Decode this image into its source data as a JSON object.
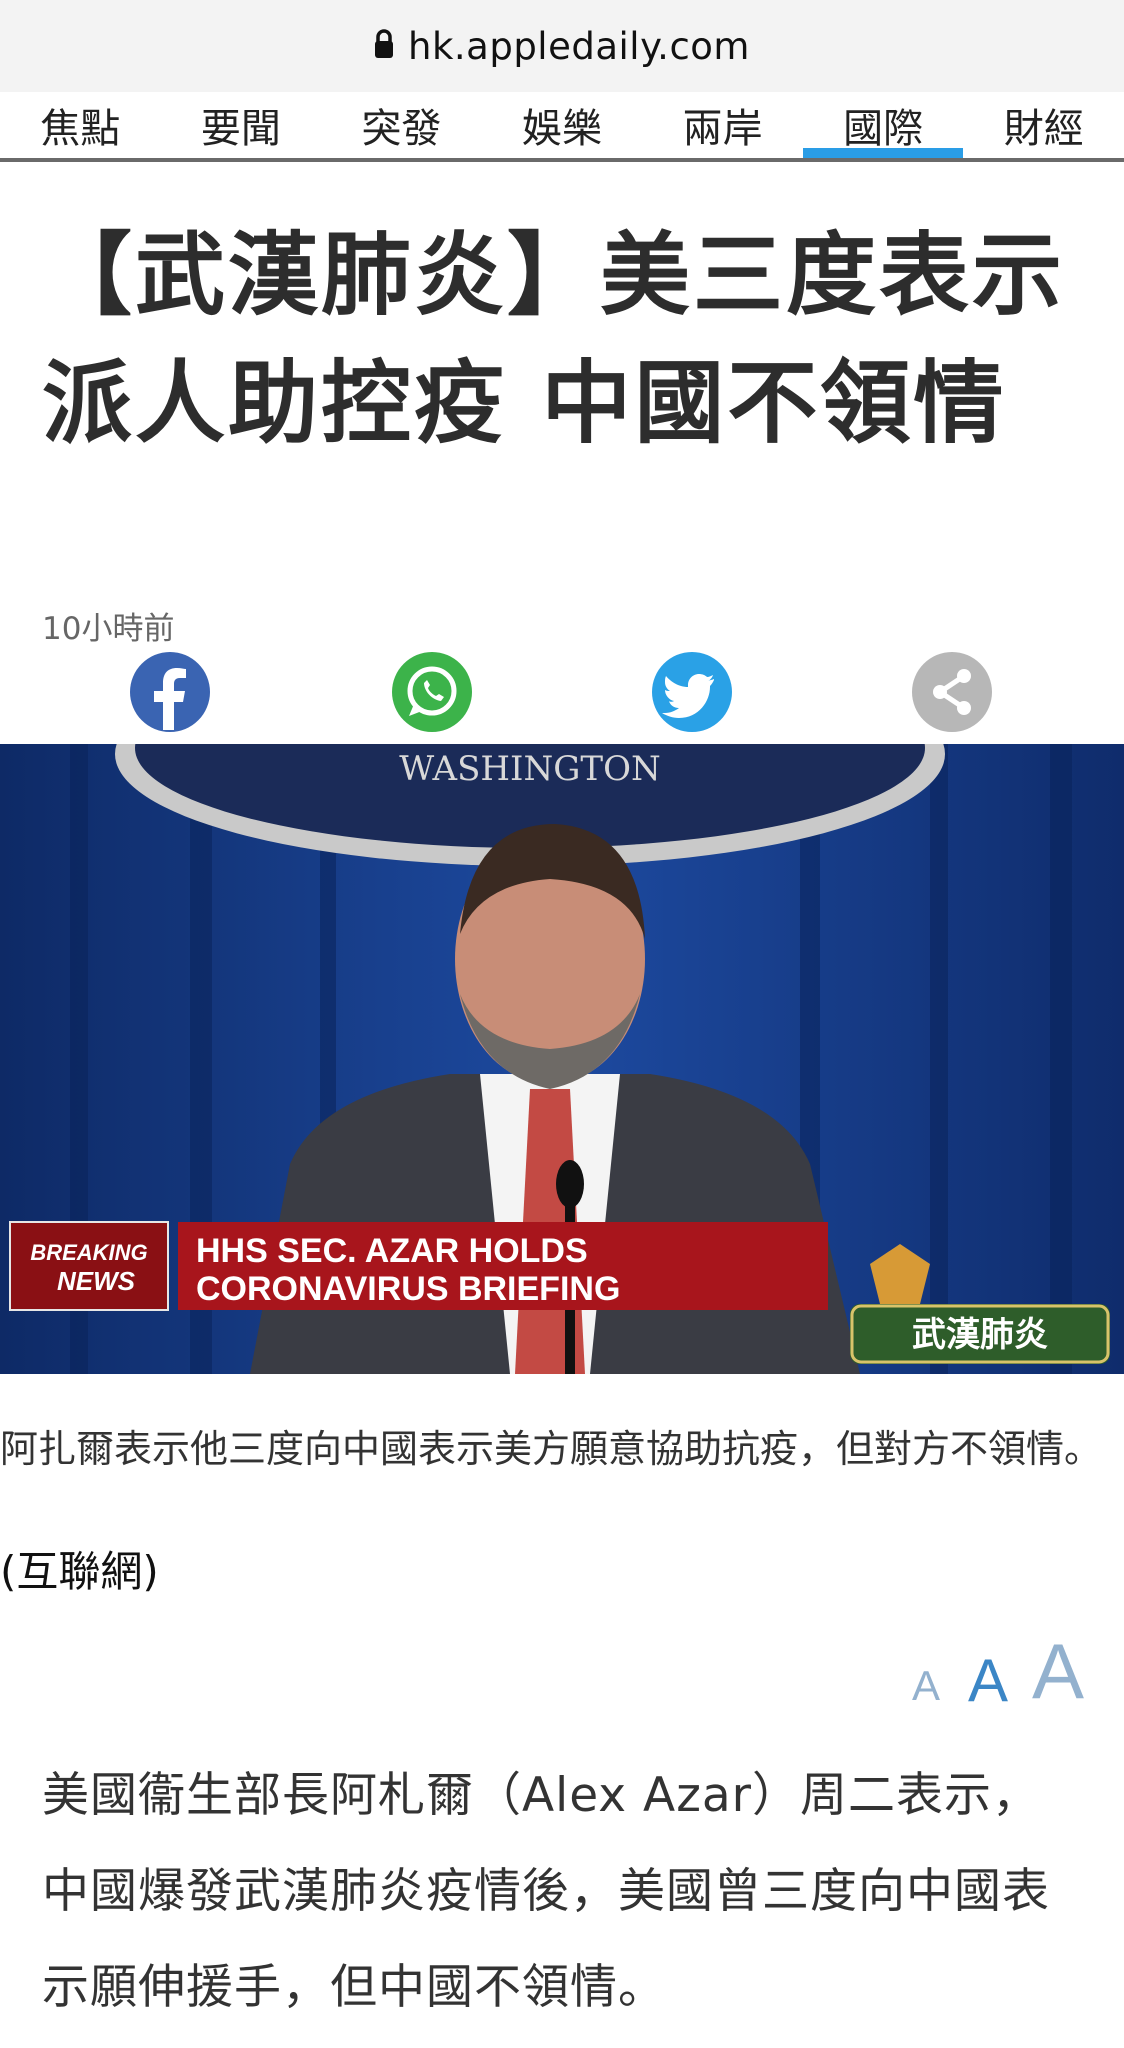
{
  "browser": {
    "url": "hk.appledaily.com"
  },
  "nav": {
    "tabs": [
      {
        "label": "焦點"
      },
      {
        "label": "要聞"
      },
      {
        "label": "突發"
      },
      {
        "label": "娛樂"
      },
      {
        "label": "兩岸"
      },
      {
        "label": "國際",
        "active": true
      },
      {
        "label": "財經"
      }
    ]
  },
  "article": {
    "headline": "【武漢肺炎】美三度表示派人助控疫 中國不領情",
    "timestamp": "10小時前",
    "share": [
      "facebook-icon",
      "whatsapp-icon",
      "twitter-icon",
      "share-icon"
    ],
    "photo": {
      "seal_text": "WASHINGTON",
      "breaking_label_1": "BREAKING",
      "breaking_label_2": "NEWS",
      "chyron_line1": "HHS SEC. AZAR HOLDS",
      "chyron_line2": "CORONAVIRUS BRIEFING",
      "badge_text": "武漢肺炎"
    },
    "caption": "阿扎爾表示他三度向中國表示美方願意協助抗疫，但對方不領情。",
    "credit": "(互聯網)",
    "font_size_controls": {
      "small": "A",
      "medium": "A",
      "large": "A"
    },
    "body": "美國衞生部長阿札爾（Alex Azar）周二表示，中國爆發武漢肺炎疫情後，美國曾三度向中國表示願伸援手，但中國不領情。"
  },
  "colors": {
    "nav_active": "#2a9de6",
    "facebook": "#3a64b2",
    "whatsapp": "#3cb34a",
    "twitter": "#2aa1e6"
  }
}
